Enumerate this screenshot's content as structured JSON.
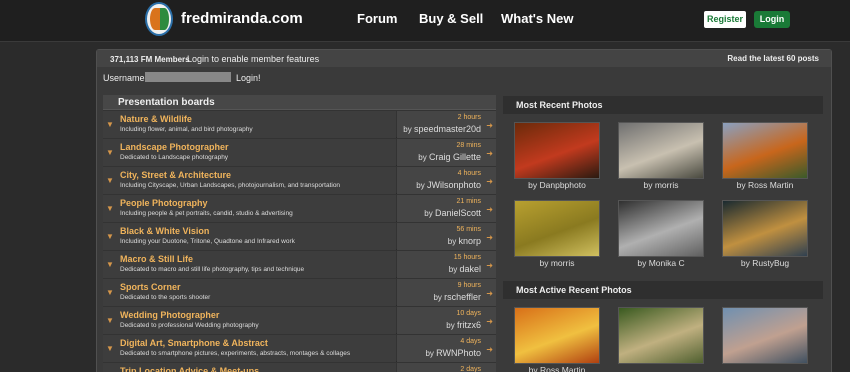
{
  "nav": {
    "brand": "fredmiranda.com",
    "links": [
      "Forum",
      "Buy & Sell",
      "What's New"
    ],
    "register": "Register",
    "login": "Login"
  },
  "panel": {
    "members": "371,113 FM Members",
    "login_note": "Login to enable member features",
    "latest": "Read the latest 60 posts",
    "username_label": "Username",
    "login_link": "Login!"
  },
  "boards": {
    "title": "Presentation boards",
    "items": [
      {
        "name": "Nature & Wildlife",
        "desc": "Including flower, animal, and bird photography",
        "time": "2 hours",
        "user": "speedmaster20d"
      },
      {
        "name": "Landscape Photographer",
        "desc": "Dedicated to Landscape photography",
        "time": "28 mins",
        "user": "Craig Gillette"
      },
      {
        "name": "City, Street & Architecture",
        "desc": "Including Cityscape, Urban Landscapes, photojournalism, and transportation",
        "time": "4 hours",
        "user": "JWilsonphoto"
      },
      {
        "name": "People Photography",
        "desc": "Including people & pet portraits, candid, studio & advertising",
        "time": "21 mins",
        "user": "DanielScott"
      },
      {
        "name": "Black & White Vision",
        "desc": "Including your Duotone, Tritone, Quadtone and Infrared work",
        "time": "56 mins",
        "user": "knorp"
      },
      {
        "name": "Macro & Still Life",
        "desc": "Dedicated to macro and still life photography, tips and technique",
        "time": "15 hours",
        "user": "dakel"
      },
      {
        "name": "Sports Corner",
        "desc": "Dedicated to the sports shooter",
        "time": "9 hours",
        "user": "rscheffler"
      },
      {
        "name": "Wedding Photographer",
        "desc": "Dedicated to professional Wedding photography",
        "time": "10 days",
        "user": "fritzx6"
      },
      {
        "name": "Digital Art, Smartphone & Abstract",
        "desc": "Dedicated to smartphone pictures, experiments, abstracts, montages & collages",
        "time": "4 days",
        "user": "RWNPhoto"
      },
      {
        "name": "Trip Location Advice & Meet-ups",
        "desc": "",
        "time": "2 days",
        "user": ""
      }
    ],
    "by_prefix": "by"
  },
  "recent": {
    "title": "Most Recent Photos",
    "photos": [
      {
        "credit": "by Danpbphoto",
        "colors": [
          "#6b2a0a",
          "#c23a1e",
          "#2a1a10"
        ]
      },
      {
        "credit": "by morris",
        "colors": [
          "#707070",
          "#c8c0b0",
          "#4a4a40"
        ]
      },
      {
        "credit": "by Ross Martin",
        "colors": [
          "#8aa0c0",
          "#c8661c",
          "#3a5a2a"
        ]
      },
      {
        "credit": "by morris",
        "colors": [
          "#b8a030",
          "#8a7a20",
          "#d0c060"
        ]
      },
      {
        "credit": "by Monika C",
        "colors": [
          "#303030",
          "#b0b0b0",
          "#606060"
        ]
      },
      {
        "credit": "by RustyBug",
        "colors": [
          "#1a2a30",
          "#c09040",
          "#304050"
        ]
      }
    ]
  },
  "active": {
    "title": "Most Active Recent Photos",
    "photos": [
      {
        "credit": "by Ross Martin",
        "colors": [
          "#d87018",
          "#f0c040",
          "#b04010"
        ]
      },
      {
        "credit": "",
        "colors": [
          "#3a5a20",
          "#c0b080",
          "#506030"
        ]
      },
      {
        "credit": "",
        "colors": [
          "#7090b0",
          "#c0a090",
          "#405060"
        ]
      }
    ]
  }
}
